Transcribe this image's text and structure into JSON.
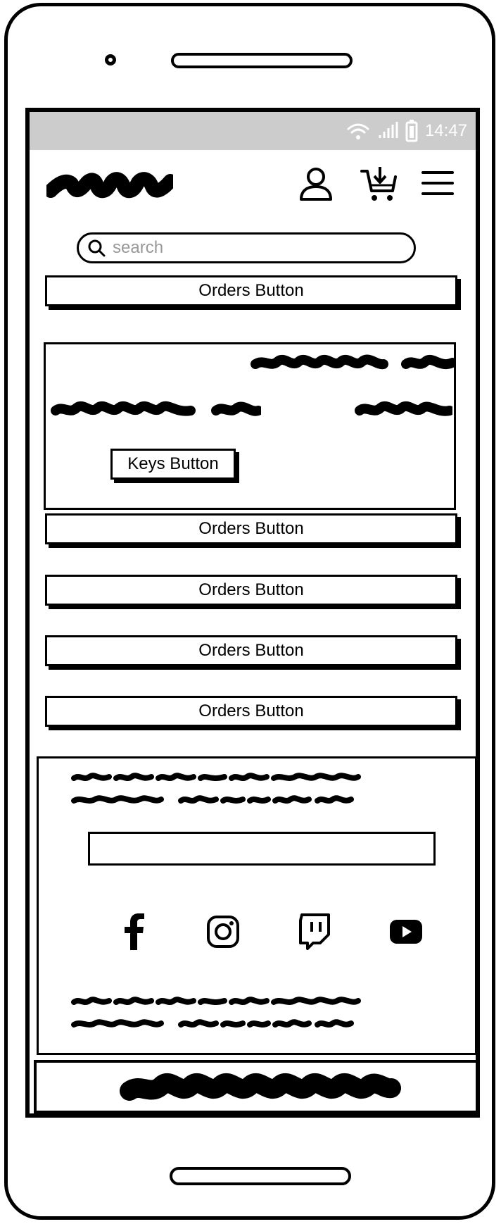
{
  "status_bar": {
    "time": "14:47",
    "icons": [
      "wifi-icon",
      "signal-icon",
      "battery-icon"
    ]
  },
  "header": {
    "icons": [
      "user-icon",
      "cart-icon",
      "menu-icon"
    ]
  },
  "search": {
    "placeholder": "search"
  },
  "buttons": {
    "orders_1": "Orders Button",
    "orders_2": "Orders Button",
    "orders_3": "Orders Button",
    "orders_4": "Orders Button",
    "orders_5": "Orders Button",
    "keys": "Keys Button"
  },
  "footer": {
    "social": [
      "facebook-icon",
      "instagram-icon",
      "twitch-icon",
      "youtube-icon"
    ]
  },
  "colors": {
    "status_bar_bg": "#cccccc",
    "ink": "#000000",
    "placeholder": "#999999"
  }
}
